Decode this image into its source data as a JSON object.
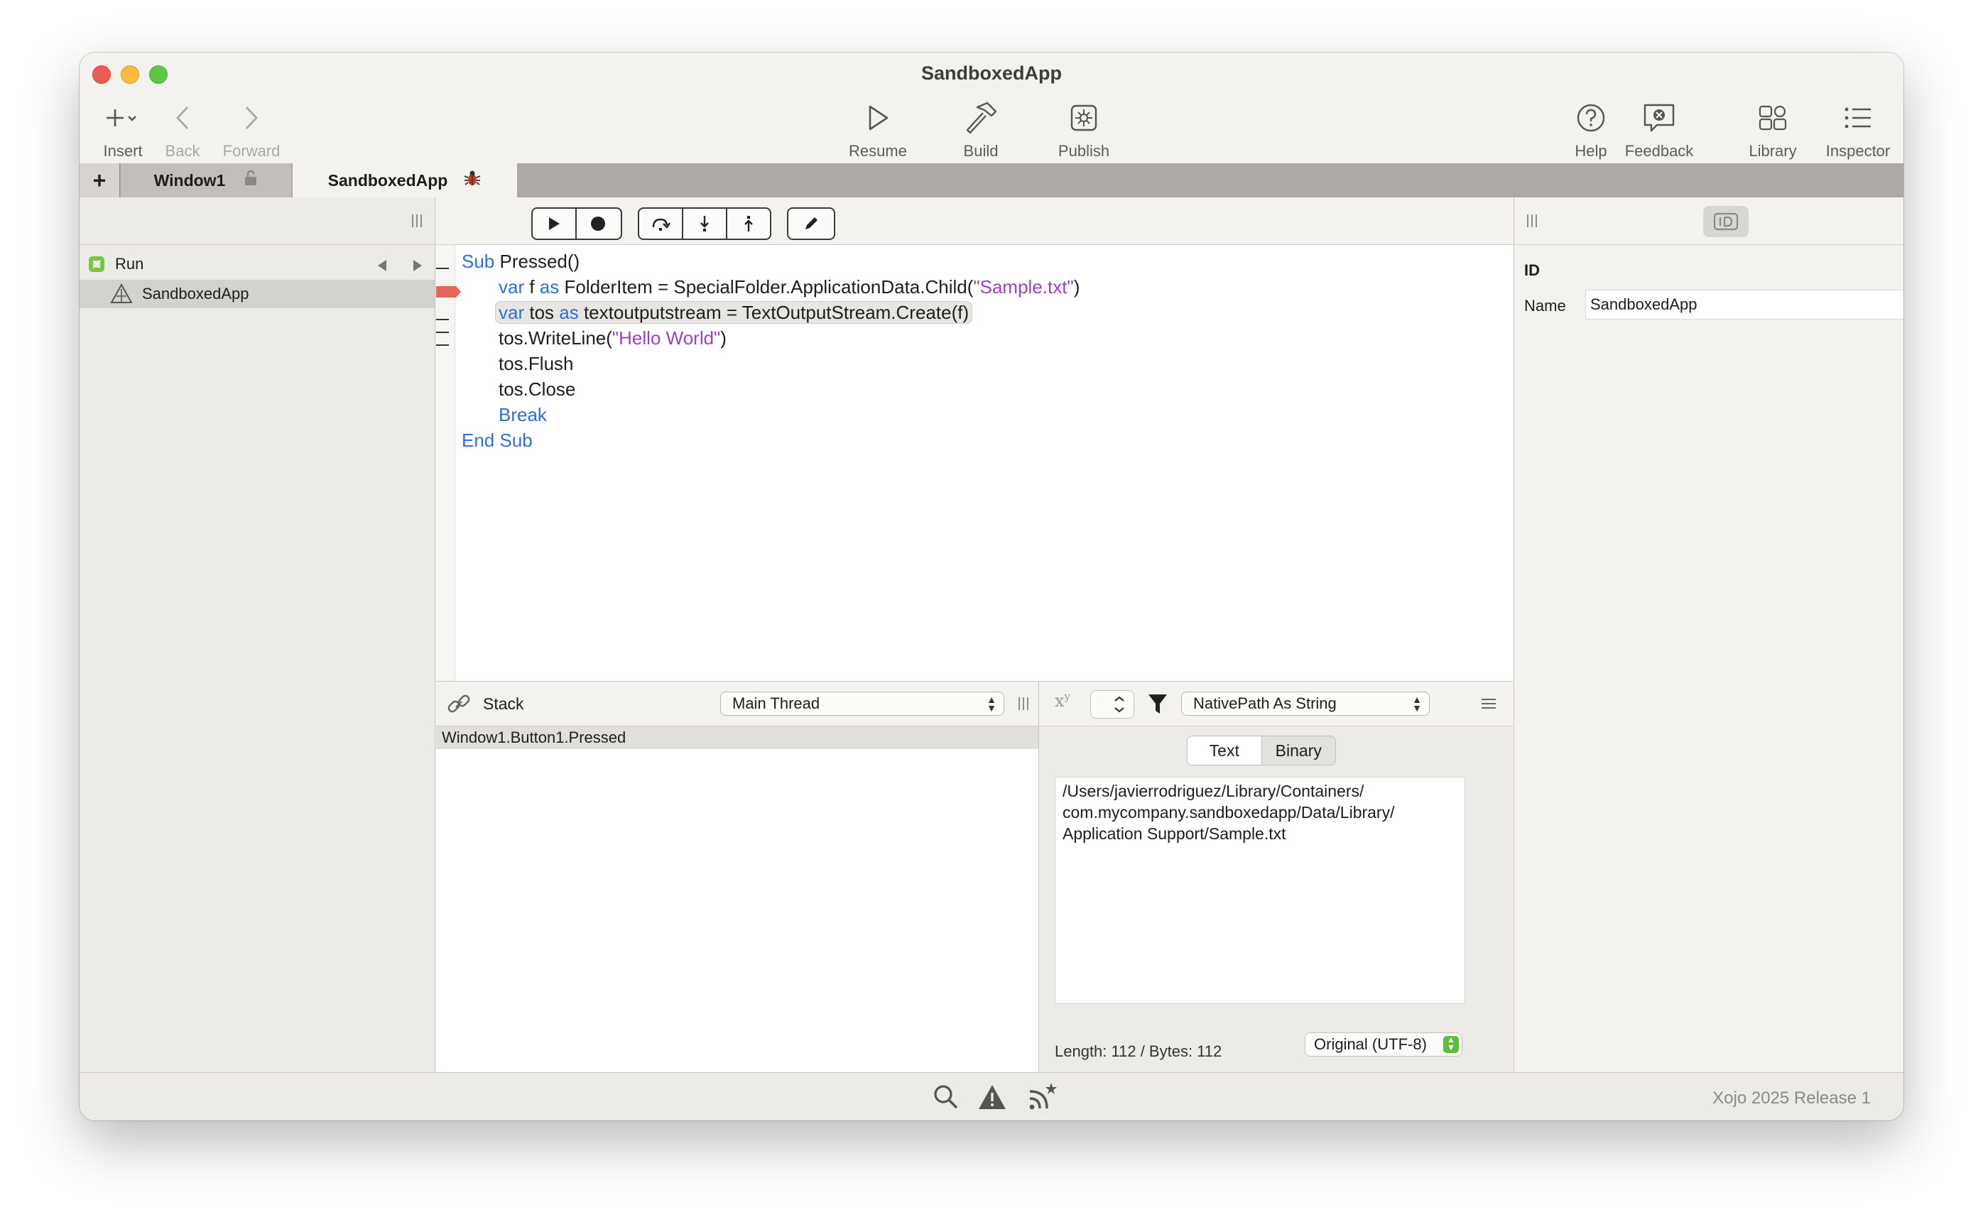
{
  "window": {
    "title": "SandboxedApp"
  },
  "toolbar": {
    "insert": "Insert",
    "back": "Back",
    "forward": "Forward",
    "resume": "Resume",
    "build": "Build",
    "publish": "Publish",
    "help": "Help",
    "feedback": "Feedback",
    "library": "Library",
    "inspector": "Inspector"
  },
  "tabs": [
    {
      "label": "Window1",
      "icon": "lock-icon"
    },
    {
      "label": "SandboxedApp",
      "icon": "bug-icon",
      "active": true
    }
  ],
  "navigator": {
    "items": [
      {
        "label": "Run",
        "icon": "run-icon"
      },
      {
        "label": "SandboxedApp",
        "icon": "app-icon",
        "selected": true
      }
    ]
  },
  "code": {
    "lines": [
      {
        "parts": [
          {
            "t": "Sub",
            "k": "kw"
          },
          {
            "t": " Pressed()",
            "k": ""
          }
        ]
      },
      {
        "parts": [
          {
            "t": "var",
            "k": "kw"
          },
          {
            "t": " f ",
            "k": ""
          },
          {
            "t": "as",
            "k": "kw"
          },
          {
            "t": " FolderItem = SpecialFolder.ApplicationData.Child(",
            "k": ""
          },
          {
            "t": "\"Sample.txt\"",
            "k": "str"
          },
          {
            "t": ")",
            "k": ""
          }
        ]
      },
      {
        "parts": [
          {
            "t": "var",
            "k": "kw"
          },
          {
            "t": " tos ",
            "k": ""
          },
          {
            "t": "as",
            "k": "kw"
          },
          {
            "t": " textoutputstream = TextOutputStream.Create(f)",
            "k": ""
          }
        ]
      },
      {
        "parts": [
          {
            "t": "tos.WriteLine(",
            "k": ""
          },
          {
            "t": "\"Hello World\"",
            "k": "str"
          },
          {
            "t": ")",
            "k": ""
          }
        ]
      },
      {
        "parts": [
          {
            "t": "tos.Flush",
            "k": ""
          }
        ]
      },
      {
        "parts": [
          {
            "t": "tos.Close",
            "k": ""
          }
        ]
      },
      {
        "parts": [
          {
            "t": "Break",
            "k": "kw"
          }
        ]
      },
      {
        "parts": [
          {
            "t": "End Sub",
            "k": "kw"
          }
        ]
      }
    ]
  },
  "stack": {
    "title": "Stack",
    "thread": "Main Thread",
    "frames": [
      "Window1.Button1.Pressed"
    ]
  },
  "variables": {
    "expression": "NativePath As String",
    "tabs": [
      "Text",
      "Binary"
    ],
    "value_lines": [
      "/Users/javierrodriguez/Library/Containers/",
      "com.mycompany.sandboxedapp/Data/Library/",
      "Application Support/Sample.txt"
    ],
    "length": "Length: 112 / Bytes: 112",
    "encoding": "Original (UTF-8)"
  },
  "inspector": {
    "section": "ID",
    "name_label": "Name",
    "name_value": "SandboxedApp"
  },
  "status": {
    "version": "Xojo 2025 Release 1"
  },
  "colors": {
    "keyword": "#2f6ed8",
    "string": "#a13ec7",
    "breakpoint": "#e8645a"
  }
}
